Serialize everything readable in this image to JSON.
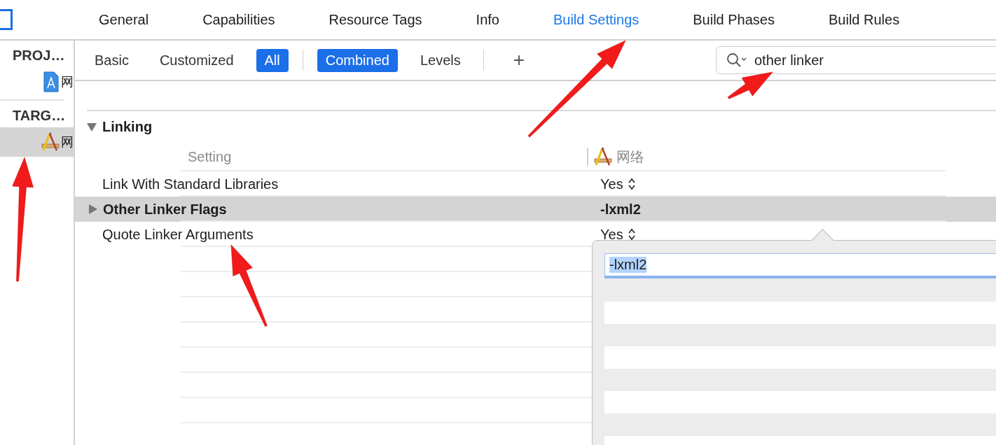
{
  "tabs": [
    {
      "label": "General",
      "selected": false
    },
    {
      "label": "Capabilities",
      "selected": false
    },
    {
      "label": "Resource Tags",
      "selected": false
    },
    {
      "label": "Info",
      "selected": false
    },
    {
      "label": "Build Settings",
      "selected": true
    },
    {
      "label": "Build Phases",
      "selected": false
    },
    {
      "label": "Build Rules",
      "selected": false
    }
  ],
  "sidebar": {
    "sections": [
      {
        "title": "PROJ…",
        "items": [
          {
            "label": "网",
            "kind": "project",
            "selected": false
          }
        ]
      },
      {
        "title": "TARG…",
        "items": [
          {
            "label": "网",
            "kind": "target",
            "selected": true
          }
        ]
      }
    ]
  },
  "scope_filters": [
    {
      "label": "Basic",
      "selected": false
    },
    {
      "label": "Customized",
      "selected": false
    },
    {
      "label": "All",
      "selected": true
    }
  ],
  "view_filters": [
    {
      "label": "Combined",
      "selected": true
    },
    {
      "label": "Levels",
      "selected": false
    }
  ],
  "add_button": "+",
  "search": {
    "value": "other linker"
  },
  "section": {
    "title": "Linking",
    "expanded": true,
    "columns": [
      "Setting",
      "网络"
    ],
    "rows": [
      {
        "name": "Link With Standard Libraries",
        "value": "Yes",
        "kind": "popup",
        "customized": false,
        "expandable": false,
        "selected": false
      },
      {
        "name": "Other Linker Flags",
        "value": "-lxml2",
        "kind": "text",
        "customized": true,
        "expandable": true,
        "selected": true
      },
      {
        "name": "Quote Linker Arguments",
        "value": "Yes",
        "kind": "popup",
        "customized": false,
        "expandable": false,
        "selected": false
      }
    ]
  },
  "editor": {
    "value": "-lxml2",
    "selected": true
  }
}
